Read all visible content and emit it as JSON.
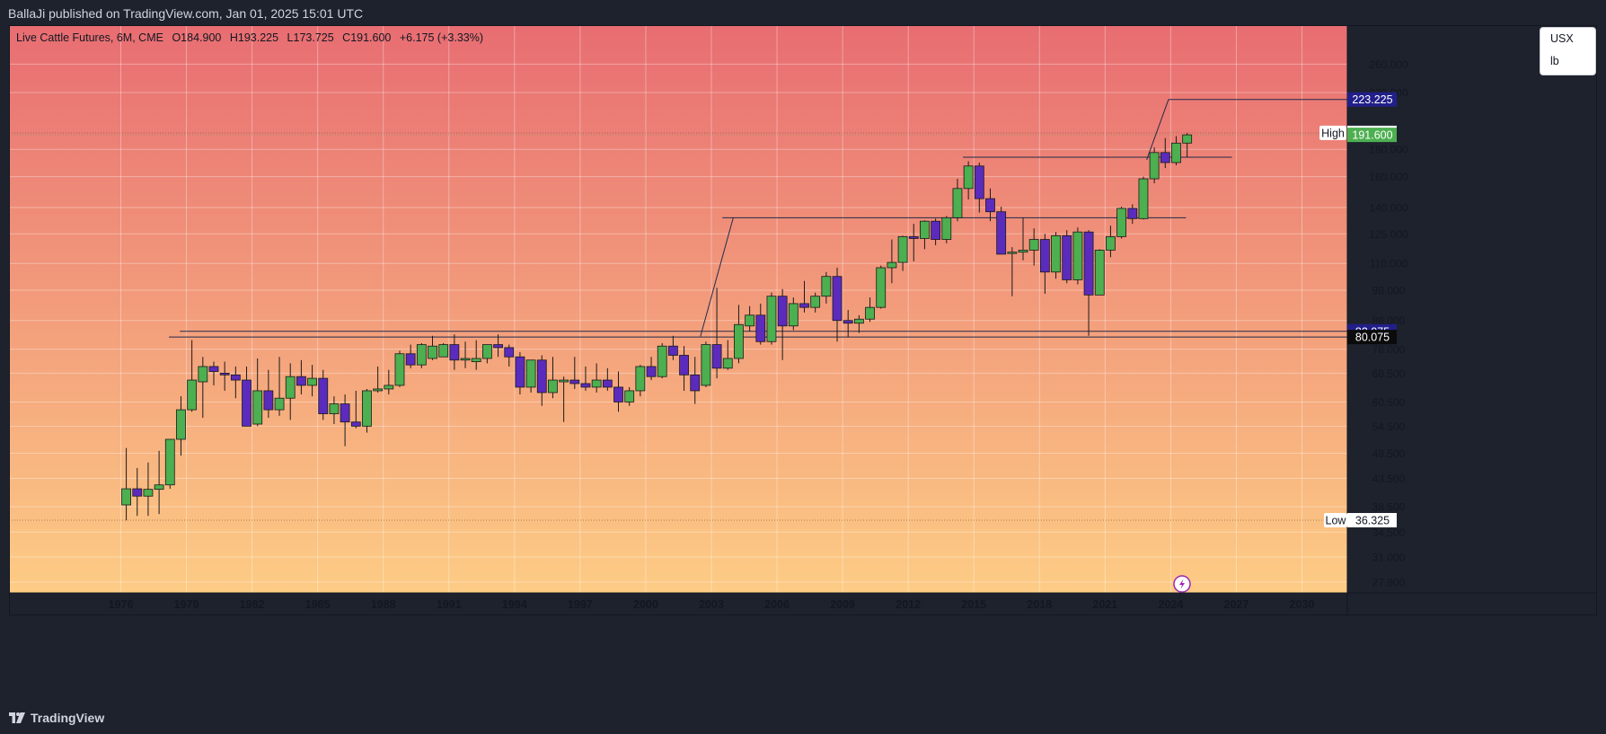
{
  "header": {
    "publisher": "BallaJi published on TradingView.com, Jan 01, 2025 15:01 UTC"
  },
  "legend": {
    "symbol": "Live Cattle Futures, 6M, CME",
    "open": "O184.900",
    "high": "H193.225",
    "low": "L173.725",
    "close": "C191.600",
    "change": "+6.175 (+3.33%)"
  },
  "unit_selector": {
    "currency": "USX",
    "unit": "lb"
  },
  "footer": {
    "brand": "TradingView"
  },
  "price_labels": {
    "level_223": "223.225",
    "high_tag": "High",
    "high_value": "193.225",
    "last": "191.600",
    "level_82": "82.075",
    "level_80": "80.075",
    "low_tag": "Low",
    "low_value": "36.325"
  },
  "colors": {
    "up": "#4caf50",
    "down": "#5b2bbd",
    "bg_top": "#e86d72",
    "bg_bottom": "#fdcc85",
    "navy_label": "#221f8a",
    "black_label": "#0b0b0b",
    "trendline": "#222a4a"
  },
  "chart_data": {
    "type": "candlestick",
    "title": "Live Cattle Futures, 6M, CME",
    "y_scale": "log",
    "ylim": [
      26.5,
      270
    ],
    "y_ticks": [
      "27.800",
      "31.000",
      "34.500",
      "38.500",
      "43.500",
      "48.500",
      "54.500",
      "60.500",
      "68.500",
      "76.000",
      "86.000",
      "98.000",
      "110.000",
      "125.000",
      "140.000",
      "160.000",
      "180.000",
      "230.000",
      "260.000"
    ],
    "x_ticks": [
      "1976",
      "1979",
      "1982",
      "1985",
      "1988",
      "1991",
      "1994",
      "1997",
      "2000",
      "2003",
      "2006",
      "2009",
      "2012",
      "2015",
      "2018",
      "2021",
      "2024",
      "2027",
      "2030"
    ],
    "candles": [
      {
        "t": "1976-01",
        "o": 38.8,
        "h": 49.6,
        "l": 36.3,
        "c": 41.6
      },
      {
        "t": "1976-07",
        "o": 41.6,
        "h": 45.5,
        "l": 37.0,
        "c": 40.3
      },
      {
        "t": "1977-01",
        "o": 40.3,
        "h": 46.6,
        "l": 37.0,
        "c": 41.5
      },
      {
        "t": "1977-07",
        "o": 41.5,
        "h": 49.0,
        "l": 37.3,
        "c": 42.3
      },
      {
        "t": "1978-01",
        "o": 42.3,
        "h": 51.5,
        "l": 41.6,
        "c": 51.5
      },
      {
        "t": "1978-07",
        "o": 51.5,
        "h": 62.0,
        "l": 48.0,
        "c": 58.5
      },
      {
        "t": "1979-01",
        "o": 58.5,
        "h": 79.0,
        "l": 58.0,
        "c": 66.5
      },
      {
        "t": "1979-07",
        "o": 66.0,
        "h": 73.5,
        "l": 56.5,
        "c": 70.5
      },
      {
        "t": "1980-01",
        "o": 70.5,
        "h": 72.0,
        "l": 65.0,
        "c": 69.0
      },
      {
        "t": "1980-07",
        "o": 68.5,
        "h": 72.0,
        "l": 63.5,
        "c": 68.0
      },
      {
        "t": "1981-01",
        "o": 68.0,
        "h": 70.5,
        "l": 61.5,
        "c": 66.5
      },
      {
        "t": "1981-07",
        "o": 66.5,
        "h": 70.5,
        "l": 54.5,
        "c": 54.5
      },
      {
        "t": "1982-01",
        "o": 55.0,
        "h": 73.0,
        "l": 54.5,
        "c": 63.5
      },
      {
        "t": "1982-07",
        "o": 63.5,
        "h": 69.5,
        "l": 56.5,
        "c": 58.5
      },
      {
        "t": "1983-01",
        "o": 58.5,
        "h": 73.5,
        "l": 57.0,
        "c": 61.5
      },
      {
        "t": "1983-07",
        "o": 61.5,
        "h": 71.5,
        "l": 56.0,
        "c": 67.5
      },
      {
        "t": "1984-01",
        "o": 67.5,
        "h": 72.5,
        "l": 62.5,
        "c": 65.0
      },
      {
        "t": "1984-07",
        "o": 65.0,
        "h": 71.0,
        "l": 62.0,
        "c": 67.0
      },
      {
        "t": "1985-01",
        "o": 67.0,
        "h": 69.5,
        "l": 56.0,
        "c": 57.5
      },
      {
        "t": "1985-07",
        "o": 57.5,
        "h": 62.0,
        "l": 55.0,
        "c": 60.0
      },
      {
        "t": "1986-01",
        "o": 60.0,
        "h": 62.5,
        "l": 50.0,
        "c": 55.5
      },
      {
        "t": "1986-07",
        "o": 55.5,
        "h": 63.5,
        "l": 54.0,
        "c": 54.5
      },
      {
        "t": "1987-01",
        "o": 54.5,
        "h": 64.0,
        "l": 53.0,
        "c": 63.5
      },
      {
        "t": "1987-07",
        "o": 63.5,
        "h": 70.5,
        "l": 63.0,
        "c": 64.0
      },
      {
        "t": "1988-01",
        "o": 64.0,
        "h": 69.5,
        "l": 62.5,
        "c": 65.0
      },
      {
        "t": "1988-07",
        "o": 65.0,
        "h": 75.5,
        "l": 64.5,
        "c": 74.5
      },
      {
        "t": "1989-01",
        "o": 74.5,
        "h": 77.5,
        "l": 70.0,
        "c": 71.0
      },
      {
        "t": "1989-07",
        "o": 71.0,
        "h": 78.0,
        "l": 70.0,
        "c": 77.5
      },
      {
        "t": "1990-01",
        "o": 73.0,
        "h": 80.5,
        "l": 72.5,
        "c": 77.0
      },
      {
        "t": "1990-07",
        "o": 73.5,
        "h": 78.0,
        "l": 73.5,
        "c": 77.5
      },
      {
        "t": "1991-01",
        "o": 77.5,
        "h": 81.0,
        "l": 69.5,
        "c": 72.5
      },
      {
        "t": "1991-07",
        "o": 72.5,
        "h": 78.5,
        "l": 70.0,
        "c": 73.0
      },
      {
        "t": "1992-01",
        "o": 72.0,
        "h": 79.0,
        "l": 69.5,
        "c": 73.0
      },
      {
        "t": "1992-07",
        "o": 73.0,
        "h": 77.0,
        "l": 71.5,
        "c": 77.5
      },
      {
        "t": "1993-01",
        "o": 77.5,
        "h": 81.0,
        "l": 73.5,
        "c": 76.5
      },
      {
        "t": "1993-07",
        "o": 76.5,
        "h": 77.5,
        "l": 70.5,
        "c": 73.5
      },
      {
        "t": "1994-01",
        "o": 73.5,
        "h": 75.0,
        "l": 62.5,
        "c": 64.5
      },
      {
        "t": "1994-07",
        "o": 64.5,
        "h": 72.5,
        "l": 63.0,
        "c": 72.5
      },
      {
        "t": "1995-01",
        "o": 72.5,
        "h": 74.0,
        "l": 59.5,
        "c": 63.0
      },
      {
        "t": "1995-07",
        "o": 63.0,
        "h": 73.5,
        "l": 61.5,
        "c": 66.5
      },
      {
        "t": "1996-01",
        "o": 66.0,
        "h": 67.5,
        "l": 55.5,
        "c": 66.5
      },
      {
        "t": "1996-07",
        "o": 66.5,
        "h": 73.5,
        "l": 64.0,
        "c": 65.5
      },
      {
        "t": "1997-01",
        "o": 65.5,
        "h": 70.5,
        "l": 63.5,
        "c": 64.5
      },
      {
        "t": "1997-07",
        "o": 64.5,
        "h": 71.5,
        "l": 63.0,
        "c": 66.5
      },
      {
        "t": "1998-01",
        "o": 66.5,
        "h": 70.0,
        "l": 63.5,
        "c": 64.5
      },
      {
        "t": "1998-07",
        "o": 64.5,
        "h": 69.0,
        "l": 58.0,
        "c": 60.5
      },
      {
        "t": "1999-01",
        "o": 60.5,
        "h": 64.5,
        "l": 59.5,
        "c": 63.5
      },
      {
        "t": "1999-07",
        "o": 63.5,
        "h": 71.0,
        "l": 62.0,
        "c": 70.5
      },
      {
        "t": "2000-01",
        "o": 70.5,
        "h": 73.5,
        "l": 66.5,
        "c": 67.5
      },
      {
        "t": "2000-07",
        "o": 67.5,
        "h": 78.0,
        "l": 67.0,
        "c": 77.0
      },
      {
        "t": "2001-01",
        "o": 77.0,
        "h": 80.5,
        "l": 72.5,
        "c": 74.0
      },
      {
        "t": "2001-07",
        "o": 74.0,
        "h": 77.0,
        "l": 63.5,
        "c": 68.0
      },
      {
        "t": "2002-01",
        "o": 68.0,
        "h": 73.5,
        "l": 60.0,
        "c": 63.5
      },
      {
        "t": "2002-07",
        "o": 65.0,
        "h": 78.5,
        "l": 64.5,
        "c": 77.5
      },
      {
        "t": "2003-01",
        "o": 77.5,
        "h": 99.0,
        "l": 67.0,
        "c": 70.0
      },
      {
        "t": "2003-07",
        "o": 70.0,
        "h": 79.0,
        "l": 69.5,
        "c": 73.0
      },
      {
        "t": "2004-01",
        "o": 73.0,
        "h": 92.0,
        "l": 71.5,
        "c": 84.5
      },
      {
        "t": "2004-07",
        "o": 84.0,
        "h": 91.5,
        "l": 82.0,
        "c": 88.0
      },
      {
        "t": "2005-01",
        "o": 88.0,
        "h": 92.5,
        "l": 77.5,
        "c": 78.5
      },
      {
        "t": "2005-07",
        "o": 78.5,
        "h": 97.0,
        "l": 77.5,
        "c": 95.5
      },
      {
        "t": "2006-01",
        "o": 95.5,
        "h": 98.5,
        "l": 72.5,
        "c": 84.0
      },
      {
        "t": "2006-07",
        "o": 84.0,
        "h": 95.0,
        "l": 82.5,
        "c": 92.5
      },
      {
        "t": "2007-01",
        "o": 92.5,
        "h": 102.0,
        "l": 89.0,
        "c": 91.0
      },
      {
        "t": "2007-07",
        "o": 91.0,
        "h": 97.0,
        "l": 89.0,
        "c": 95.5
      },
      {
        "t": "2008-01",
        "o": 95.5,
        "h": 106.0,
        "l": 92.5,
        "c": 104.0
      },
      {
        "t": "2008-07",
        "o": 104.0,
        "h": 108.0,
        "l": 78.5,
        "c": 86.0
      },
      {
        "t": "2009-01",
        "o": 86.0,
        "h": 90.0,
        "l": 80.0,
        "c": 85.0
      },
      {
        "t": "2009-07",
        "o": 85.0,
        "h": 88.0,
        "l": 81.5,
        "c": 86.5
      },
      {
        "t": "2010-01",
        "o": 86.5,
        "h": 95.0,
        "l": 85.5,
        "c": 91.0
      },
      {
        "t": "2010-07",
        "o": 91.0,
        "h": 109.0,
        "l": 90.5,
        "c": 108.0
      },
      {
        "t": "2011-01",
        "o": 108.0,
        "h": 122.0,
        "l": 101.0,
        "c": 110.5
      },
      {
        "t": "2011-07",
        "o": 110.5,
        "h": 124.0,
        "l": 106.5,
        "c": 123.5
      },
      {
        "t": "2012-01",
        "o": 123.5,
        "h": 130.5,
        "l": 111.0,
        "c": 122.5
      },
      {
        "t": "2012-07",
        "o": 122.5,
        "h": 132.5,
        "l": 117.0,
        "c": 132.0
      },
      {
        "t": "2013-01",
        "o": 132.0,
        "h": 133.5,
        "l": 119.0,
        "c": 122.0
      },
      {
        "t": "2013-07",
        "o": 122.0,
        "h": 135.0,
        "l": 120.0,
        "c": 134.0
      },
      {
        "t": "2014-01",
        "o": 134.0,
        "h": 158.5,
        "l": 132.0,
        "c": 152.0
      },
      {
        "t": "2014-07",
        "o": 152.0,
        "h": 171.0,
        "l": 145.0,
        "c": 167.5
      },
      {
        "t": "2015-01",
        "o": 167.5,
        "h": 170.0,
        "l": 137.0,
        "c": 145.5
      },
      {
        "t": "2015-07",
        "o": 145.5,
        "h": 152.0,
        "l": 132.0,
        "c": 137.5
      },
      {
        "t": "2016-01",
        "o": 137.5,
        "h": 140.5,
        "l": 119.0,
        "c": 114.5
      },
      {
        "t": "2016-07",
        "o": 115.0,
        "h": 118.0,
        "l": 95.5,
        "c": 115.5
      },
      {
        "t": "2017-01",
        "o": 115.5,
        "h": 134.0,
        "l": 111.5,
        "c": 116.5
      },
      {
        "t": "2017-07",
        "o": 116.5,
        "h": 128.0,
        "l": 109.0,
        "c": 122.0
      },
      {
        "t": "2018-01",
        "o": 122.0,
        "h": 125.0,
        "l": 96.5,
        "c": 106.0
      },
      {
        "t": "2018-07",
        "o": 106.0,
        "h": 126.0,
        "l": 103.0,
        "c": 124.0
      },
      {
        "t": "2019-01",
        "o": 124.0,
        "h": 127.0,
        "l": 101.0,
        "c": 102.5
      },
      {
        "t": "2019-07",
        "o": 102.5,
        "h": 128.5,
        "l": 100.5,
        "c": 126.0
      },
      {
        "t": "2020-01",
        "o": 126.0,
        "h": 127.0,
        "l": 80.5,
        "c": 96.0
      },
      {
        "t": "2020-07",
        "o": 96.0,
        "h": 117.0,
        "l": 96.0,
        "c": 116.5
      },
      {
        "t": "2021-01",
        "o": 116.5,
        "h": 129.5,
        "l": 113.0,
        "c": 123.5
      },
      {
        "t": "2021-07",
        "o": 123.5,
        "h": 140.5,
        "l": 122.5,
        "c": 139.5
      },
      {
        "t": "2022-01",
        "o": 139.5,
        "h": 142.0,
        "l": 130.5,
        "c": 133.5
      },
      {
        "t": "2022-07",
        "o": 133.5,
        "h": 160.0,
        "l": 133.0,
        "c": 158.5
      },
      {
        "t": "2023-01",
        "o": 158.5,
        "h": 181.5,
        "l": 155.5,
        "c": 177.5
      },
      {
        "t": "2023-07",
        "o": 177.5,
        "h": 189.0,
        "l": 166.0,
        "c": 170.0
      },
      {
        "t": "2024-01",
        "o": 170.0,
        "h": 190.5,
        "l": 168.0,
        "c": 184.9
      },
      {
        "t": "2024-07",
        "o": 184.9,
        "h": 193.225,
        "l": 173.725,
        "c": 191.6
      }
    ],
    "horizontal_levels": [
      223.225,
      82.075,
      80.075,
      174.0,
      134.0
    ],
    "high": 193.225,
    "low": 36.325,
    "last": 191.6
  }
}
